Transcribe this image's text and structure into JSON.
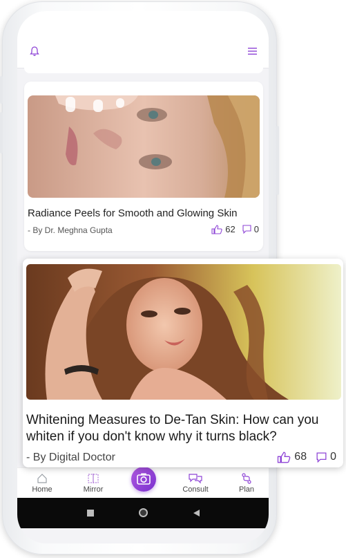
{
  "colors": {
    "accent": "#8e44d6",
    "text": "#1f1f1f",
    "muted": "#555555"
  },
  "header": {
    "bell_icon": "bell-icon",
    "menu_icon": "menu-icon"
  },
  "articles": [
    {
      "title": "Radiance Peels for Smooth and Glowing Skin",
      "author": "- By Dr. Meghna Gupta",
      "likes": "62",
      "comments": "0"
    },
    {
      "title": "Whitening Measures to De-Tan Skin: How can you whiten if you don't know why it turns black?",
      "author": "- By Digital Doctor",
      "likes": "68",
      "comments": "0"
    }
  ],
  "nav": {
    "home": "Home",
    "mirror": "Mirror",
    "consult": "Consult",
    "plan": "Plan"
  }
}
